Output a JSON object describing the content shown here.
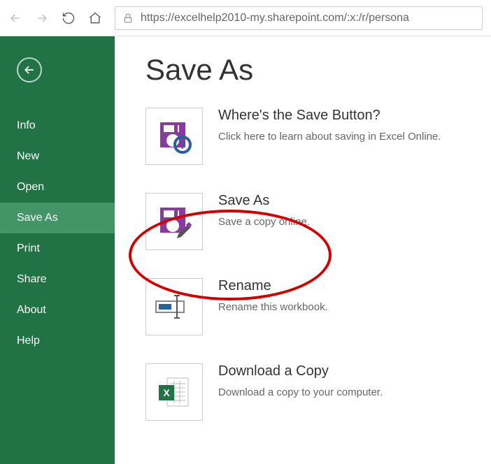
{
  "browser": {
    "url": "https://excelhelp2010-my.sharepoint.com/:x:/r/persona"
  },
  "sidebar": {
    "items": [
      {
        "label": "Info"
      },
      {
        "label": "New"
      },
      {
        "label": "Open"
      },
      {
        "label": "Save As"
      },
      {
        "label": "Print"
      },
      {
        "label": "Share"
      },
      {
        "label": "About"
      },
      {
        "label": "Help"
      }
    ],
    "active_index": 3
  },
  "page": {
    "title": "Save As",
    "options": [
      {
        "title": "Where's the Save Button?",
        "desc": "Click here to learn about saving in Excel Online.",
        "icon": "save-question-icon"
      },
      {
        "title": "Save As",
        "desc": "Save a copy online.",
        "icon": "save-as-icon"
      },
      {
        "title": "Rename",
        "desc": "Rename this workbook.",
        "icon": "rename-icon"
      },
      {
        "title": "Download a Copy",
        "desc": "Download a copy to your computer.",
        "icon": "download-excel-icon"
      }
    ],
    "highlighted_index": 1
  },
  "colors": {
    "brand_green": "#217346",
    "accent_purple": "#883a9e",
    "highlight_red": "#d40000"
  }
}
